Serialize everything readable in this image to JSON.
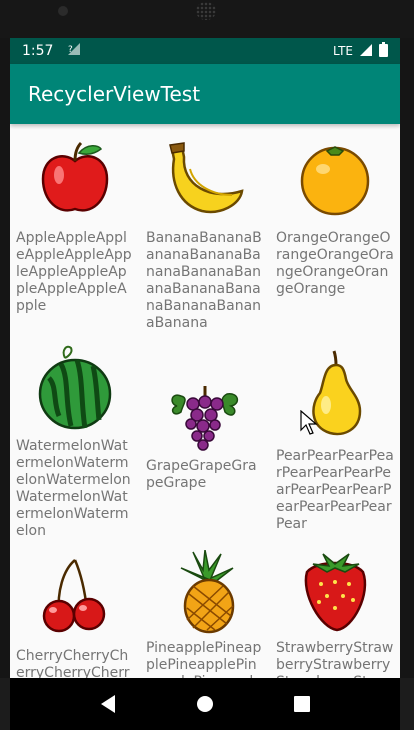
{
  "status_bar": {
    "time": "1:57",
    "network": "LTE"
  },
  "app_bar": {
    "title": "RecyclerViewTest"
  },
  "fruits": [
    {
      "icon": "apple-icon",
      "name": "AppleAppleAppleAppleAppleAppleAppleAppleAppleAppleAppleApple"
    },
    {
      "icon": "banana-icon",
      "name": "BananaBananaBananaBananaBananaBananaBananaBananaBananaBananaBananaBanana"
    },
    {
      "icon": "orange-icon",
      "name": "OrangeOrangeOrangeOrangeOrangeOrangeOrangeOrange"
    },
    {
      "icon": "watermelon-icon",
      "name": "WatermelonWatermelonWatermelonWatermelonWatermelonWatermelonWatermelon"
    },
    {
      "icon": "grape-icon",
      "name": "GrapeGrapeGrapeGrape"
    },
    {
      "icon": "pear-icon",
      "name": "PearPearPearPearPearPearPearPearPearPearPearPearPearPearPearPear"
    },
    {
      "icon": "cherry-icon",
      "name": "CherryCherryCherryCherryCherryCherryCherryCherryCherry"
    },
    {
      "icon": "pineapple-icon",
      "name": "PineapplePineapplePineapplePineapplePineapplePineapple"
    },
    {
      "icon": "strawberry-icon",
      "name": "StrawberryStrawberryStrawberryStrawberryStrawberryStr"
    }
  ],
  "colors": {
    "primary": "#008577",
    "primary_dark": "#00574b",
    "text": "#757575"
  }
}
